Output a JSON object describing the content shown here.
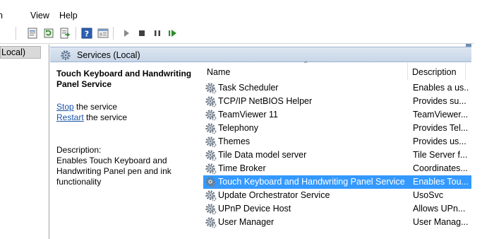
{
  "menubar": {
    "truncated": "n",
    "view": "View",
    "help": "Help"
  },
  "toolbar": {
    "buttons": [
      "properties-icon",
      "refresh-icon",
      "export-list-icon",
      "help-icon",
      "show-hide-pane-icon",
      "start-icon",
      "stop-icon",
      "pause-icon",
      "restart-icon"
    ]
  },
  "tree": {
    "selected_label": "Local)"
  },
  "header": {
    "title": "Services (Local)"
  },
  "extended": {
    "title": "Touch Keyboard and Handwriting Panel Service",
    "stop_link": "Stop",
    "stop_suffix": " the service",
    "restart_link": "Restart",
    "restart_suffix": " the service",
    "description_label": "Description:",
    "description": "Enables Touch Keyboard and Handwriting Panel pen and ink functionality"
  },
  "list": {
    "columns": {
      "name": "Name",
      "description": "Description"
    },
    "rows": [
      {
        "name": "Task Scheduler",
        "description": "Enables a us..."
      },
      {
        "name": "TCP/IP NetBIOS Helper",
        "description": "Provides su..."
      },
      {
        "name": "TeamViewer 11",
        "description": "TeamViewer..."
      },
      {
        "name": "Telephony",
        "description": "Provides Tel..."
      },
      {
        "name": "Themes",
        "description": "Provides us..."
      },
      {
        "name": "Tile Data model server",
        "description": "Tile Server f..."
      },
      {
        "name": "Time Broker",
        "description": "Coordinates..."
      },
      {
        "name": "Touch Keyboard and Handwriting Panel Service",
        "description": "Enables Tou...",
        "selected": true
      },
      {
        "name": "Update Orchestrator Service",
        "description": "UsoSvc"
      },
      {
        "name": "UPnP Device Host",
        "description": "Allows UPn..."
      },
      {
        "name": "User Manager",
        "description": "User Manag..."
      }
    ]
  },
  "colors": {
    "selection": "#3399ff",
    "link": "#1a53a8",
    "header_gradient_top": "#dde6f1",
    "header_gradient_bottom": "#c7d6e8"
  }
}
